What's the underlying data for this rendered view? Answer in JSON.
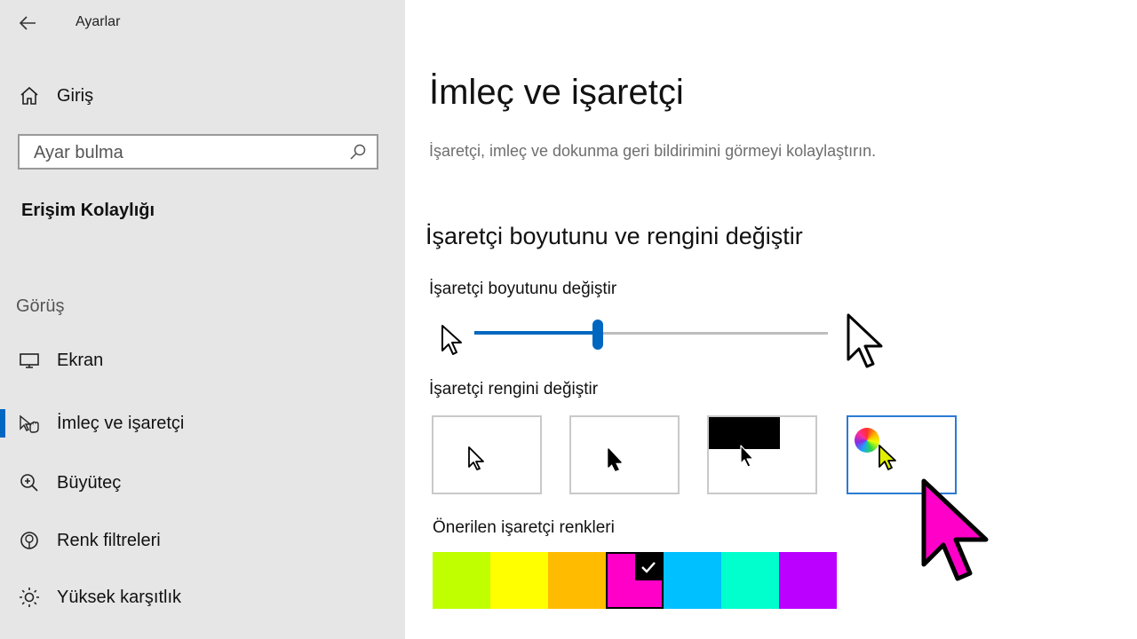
{
  "app": {
    "title": "Ayarlar"
  },
  "sidebar": {
    "home_label": "Giriş",
    "search_placeholder": "Ayar bulma",
    "section_title": "Erişim Kolaylığı",
    "group_heading": "Görüş",
    "items": [
      {
        "label": "Ekran",
        "icon": "monitor-icon",
        "active": false
      },
      {
        "label": "İmleç ve işaretçi",
        "icon": "pointer-hand-icon",
        "active": true
      },
      {
        "label": "Büyüteç",
        "icon": "magnifier-icon",
        "active": false
      },
      {
        "label": "Renk filtreleri",
        "icon": "color-filter-icon",
        "active": false
      },
      {
        "label": "Yüksek karşıtlık",
        "icon": "brightness-icon",
        "active": false
      }
    ]
  },
  "main": {
    "page_title": "İmleç ve işaretçi",
    "description": "İşaretçi, imleç ve dokunma geri bildirimini görmeyi kolaylaştırın.",
    "section_title": "İşaretçi boyutunu ve rengini değiştir",
    "size_label": "İşaretçi boyutunu değiştir",
    "size_value_fraction": 0.35,
    "color_label": "İşaretçi rengini değiştir",
    "color_options": [
      {
        "name": "white",
        "selected": false
      },
      {
        "name": "black",
        "selected": false
      },
      {
        "name": "inverted",
        "selected": false
      },
      {
        "name": "custom",
        "selected": true
      }
    ],
    "suggested_label": "Önerilen işaretçi renkleri",
    "suggested_colors": [
      {
        "color": "#bfff00",
        "selected": false
      },
      {
        "color": "#ffff00",
        "selected": false
      },
      {
        "color": "#ffbb00",
        "selected": false
      },
      {
        "color": "#ff00c8",
        "selected": true
      },
      {
        "color": "#00c0ff",
        "selected": false
      },
      {
        "color": "#00ffcc",
        "selected": false
      },
      {
        "color": "#bb00ff",
        "selected": false
      }
    ]
  },
  "colors": {
    "accent": "#0067c0",
    "pointer_custom": "#ff00c8",
    "sidebar_bg": "#e6e6e6"
  }
}
